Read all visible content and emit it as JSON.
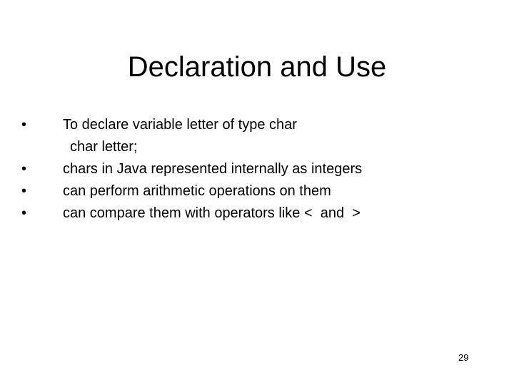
{
  "slide": {
    "title": "Declaration and Use",
    "bullet_glyph": "•",
    "bullets": [
      {
        "text": "To declare variable letter of type char",
        "sub": "char letter;"
      },
      {
        "text": "chars in Java represented internally as integers"
      },
      {
        "text": "can perform arithmetic operations on them"
      },
      {
        "text": "can compare them with operators like <  and  >"
      }
    ],
    "page_number": "29"
  }
}
